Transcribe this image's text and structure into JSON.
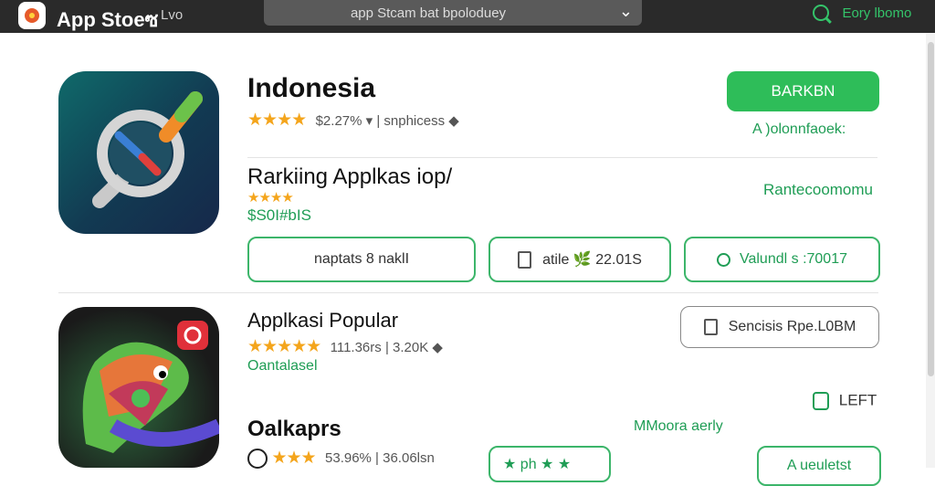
{
  "header": {
    "app_name": "App Stoeซ",
    "sub_label": "Lvo",
    "search_query": "app Stcam bat bpoloduey",
    "right_label": "Eory lbomo"
  },
  "featured": {
    "title": "Indonesia",
    "stars": "★★★★",
    "rating_text": "$2.27% ▾ | snphicess ◆",
    "primary_button": "BARKBN",
    "secondary_link": "A )olonnfaoek:",
    "section_title": "Rarkiing Applkas iop/",
    "section_stars": "★★★★",
    "section_price": "$S0I#bIS",
    "right_link": "Rantecoomomu",
    "pills": [
      {
        "icon": "user-icon",
        "text": "naptats 8 naklI"
      },
      {
        "icon": "doc-icon",
        "text": "atile 🌿 22.01S"
      },
      {
        "icon": "lock-icon",
        "text": "Valundl s :70017"
      }
    ]
  },
  "popular": {
    "title": "Applkasi Popular",
    "stars": "★★★★★",
    "rating_text": "111.36rs | 3.20K ◆",
    "tag": "Oantalasel",
    "services_button": "Sencisis Rpe.L0BM",
    "left_button": "LEFT",
    "more_link": "MMoora aerly"
  },
  "third": {
    "title": "Oalkaprs",
    "stars": "★★★",
    "rating_text": "53.96% | 36.06lsn",
    "pill_text": "★ ph ★ ★",
    "pill2_text": "A ueuletst"
  },
  "colors": {
    "accent_green": "#2ebd59",
    "topbar": "#2a2a2a"
  }
}
